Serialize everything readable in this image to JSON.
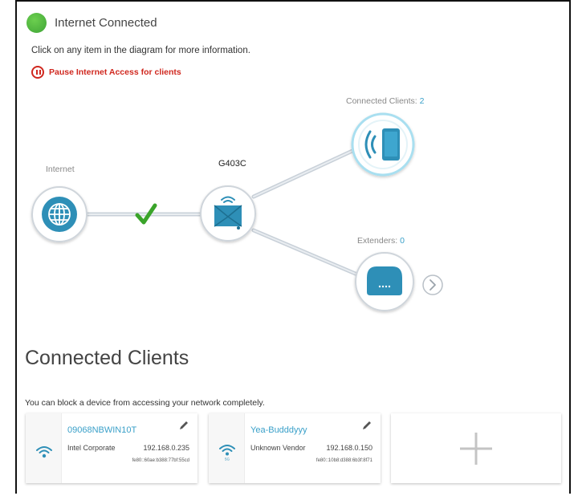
{
  "status": {
    "text": "Internet Connected",
    "color": "#4caf50"
  },
  "hint": "Click on any item in the diagram for more information.",
  "pause": {
    "label": "Pause Internet Access for clients",
    "color": "#d0281f",
    "icon": "pause-circle-icon"
  },
  "diagram": {
    "internet_label": "Internet",
    "router_label": "G403C",
    "clients_label": "Connected Clients:",
    "clients_count": "2",
    "extenders_label": "Extenders:",
    "extenders_count": "0",
    "link_status_icon": "checkmark-icon",
    "accent": "#2e8fb7"
  },
  "clients_section": {
    "title": "Connected Clients",
    "block_hint": "You can block a device from accessing your network completely.",
    "clients": [
      {
        "name": "09068NBWIN10T",
        "vendor": "Intel Corporate",
        "ip": "192.168.0.235",
        "mac": "fe80::60ae:b388:77bf:55cd",
        "icon": "wifi-icon"
      },
      {
        "name": "Yea-Budddyyy",
        "vendor": "Unknown Vendor",
        "ip": "192.168.0.150",
        "mac": "fe80::10b8:d388:6b3f:8f71",
        "icon": "wifi-5g-icon",
        "band": "5G"
      }
    ],
    "add_icon": "plus-icon"
  }
}
